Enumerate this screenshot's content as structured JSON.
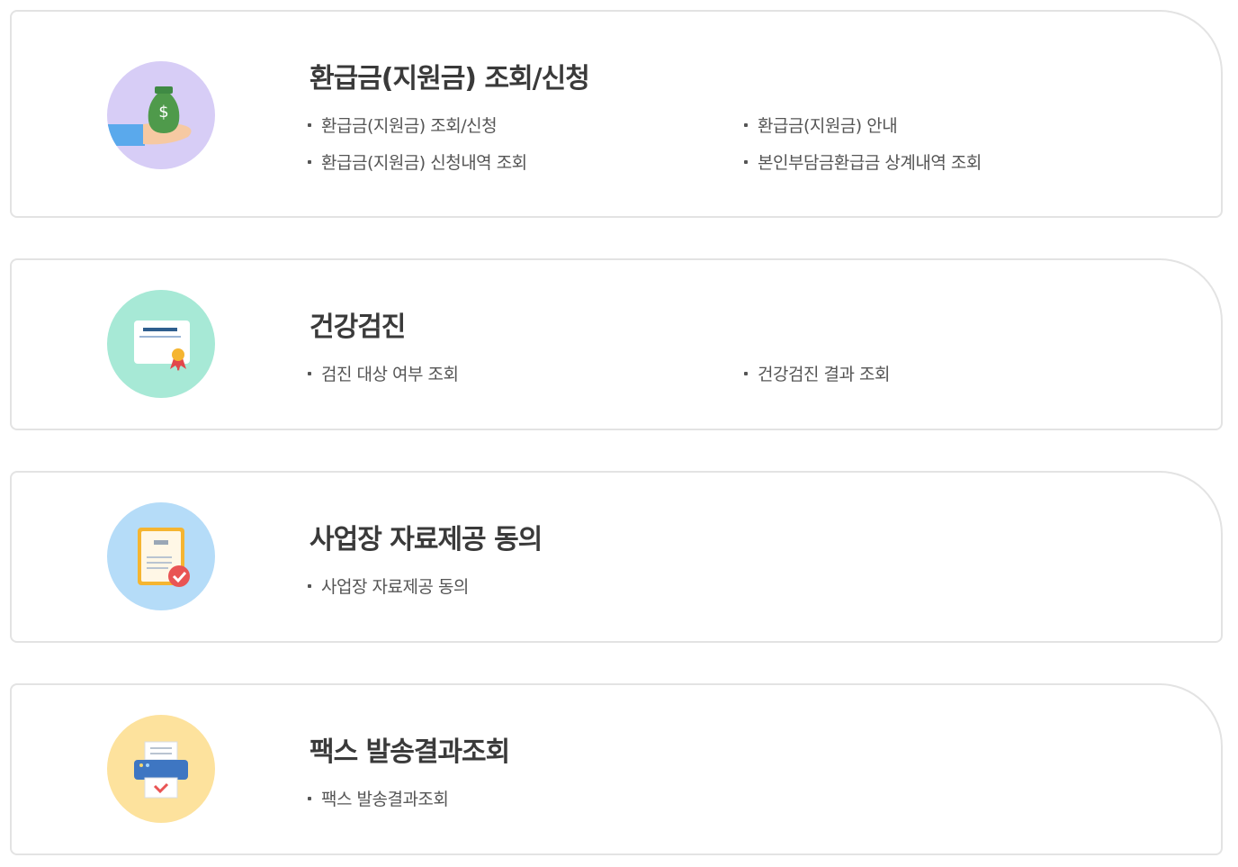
{
  "cards": [
    {
      "title": "환급금(지원금) 조회/신청",
      "icon": "money-bag-icon",
      "icon_bg": "#d7cdf6",
      "links": [
        "환급금(지원금) 조회/신청",
        "환급금(지원금) 안내",
        "환급금(지원금) 신청내역 조회",
        "본인부담금환급금 상계내역 조회"
      ]
    },
    {
      "title": "건강검진",
      "icon": "certificate-icon",
      "icon_bg": "#a7e9d6",
      "links": [
        "검진 대상 여부 조회",
        "건강검진 결과 조회"
      ]
    },
    {
      "title": "사업장 자료제공 동의",
      "icon": "document-check-icon",
      "icon_bg": "#b5dcf8",
      "links": [
        "사업장 자료제공 동의"
      ]
    },
    {
      "title": "팩스 발송결과조회",
      "icon": "fax-printer-icon",
      "icon_bg": "#fde29d",
      "links": [
        "팩스 발송결과조회"
      ]
    }
  ]
}
